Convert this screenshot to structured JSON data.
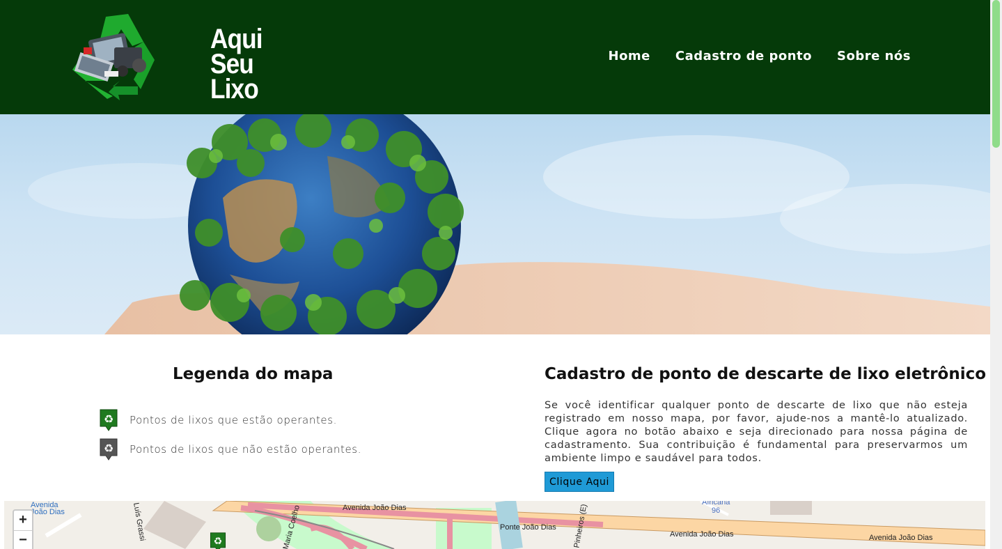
{
  "header": {
    "logo_lines": [
      "Aqui",
      "Seu",
      "Lixo"
    ],
    "nav": [
      {
        "label": "Home"
      },
      {
        "label": "Cadastro de ponto"
      },
      {
        "label": "Sobre nós"
      }
    ],
    "background": "#053a09"
  },
  "legend": {
    "title": "Legenda do mapa",
    "items": [
      {
        "icon": "recycle-pin-green-icon",
        "color": "#1f7a1f",
        "label": "Pontos de lixos que estão operantes."
      },
      {
        "icon": "recycle-pin-gray-icon",
        "color": "#555555",
        "label": "Pontos de lixos que não estão operantes."
      }
    ]
  },
  "cadastro": {
    "title": "Cadastro de ponto de descarte de lixo eletrônico",
    "text": "Se você identificar qualquer ponto de descarte de lixo que não esteja registrado em nosso mapa, por favor, ajude-nos a mantê-lo atualizado. Clique agora no botão abaixo e seja direcionado para nossa página de cadastramento. Sua contribuição é fundamental para preservarmos um ambiente limpo e saudável para todos.",
    "button": "Clique Aqui",
    "button_color": "#1f9ad6"
  },
  "map": {
    "zoom_in": "+",
    "zoom_out": "−",
    "labels": [
      "Avenida",
      "João Dias",
      "Avenida João Dias",
      "Ponte João Dias",
      "Avenida João Dias",
      "Avenida João Dias",
      "Africana",
      "96",
      "Luís Grassi",
      "Maria Coelho",
      "Pinheiros (E)"
    ]
  }
}
